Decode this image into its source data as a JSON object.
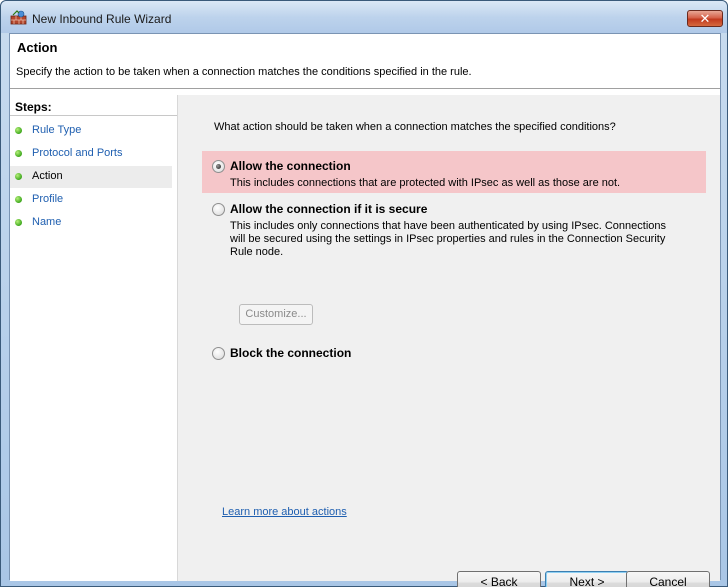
{
  "window": {
    "title": "New Inbound Rule Wizard",
    "close_glyph": "✕"
  },
  "header": {
    "title": "Action",
    "description": "Specify the action to be taken when a connection matches the conditions specified in the rule."
  },
  "steps": {
    "title": "Steps:",
    "items": [
      {
        "label": "Rule Type",
        "current": false
      },
      {
        "label": "Protocol and Ports",
        "current": false
      },
      {
        "label": "Action",
        "current": true
      },
      {
        "label": "Profile",
        "current": false
      },
      {
        "label": "Name",
        "current": false
      }
    ]
  },
  "main": {
    "question": "What action should be taken when a connection matches the specified conditions?",
    "options": [
      {
        "label": "Allow the connection",
        "description": "This includes connections that are protected with IPsec as well as those are not.",
        "selected": true
      },
      {
        "label": "Allow the connection if it is secure",
        "description": "This includes only connections that have been authenticated by using IPsec.  Connections will be secured using the settings in IPsec properties and rules in the Connection Security Rule node.",
        "selected": false
      },
      {
        "label": "Block the connection",
        "selected": false
      }
    ],
    "customize_label": "Customize...",
    "learn_more": "Learn more about actions"
  },
  "footer": {
    "back_label": "< Back",
    "next_label": "Next >",
    "cancel_label": "Cancel"
  },
  "colors": {
    "highlight": "#f5c6c9",
    "link": "#1f5fb0"
  }
}
